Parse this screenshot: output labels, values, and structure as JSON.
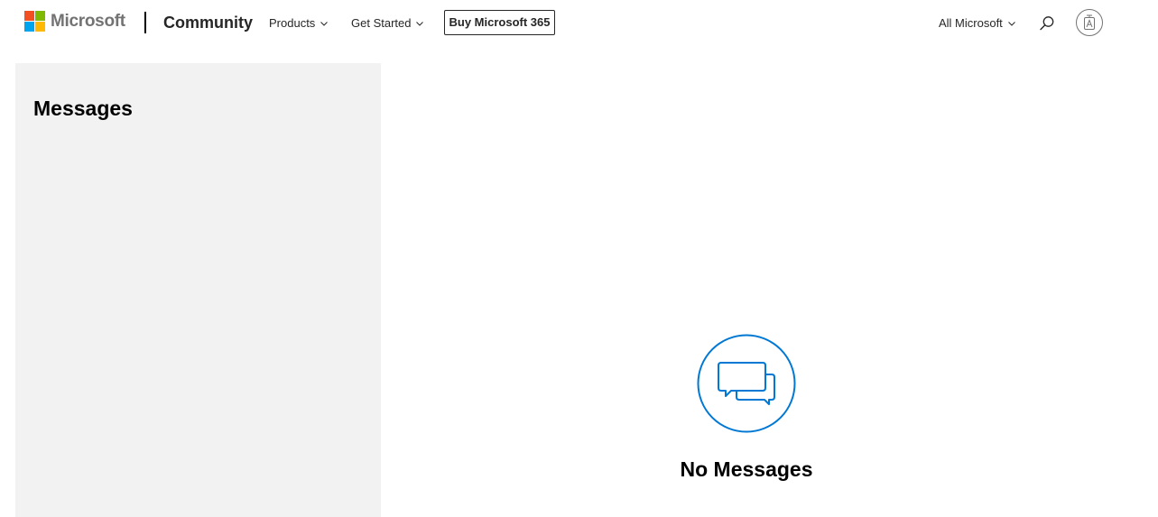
{
  "header": {
    "brand": "Microsoft",
    "site_name": "Community",
    "nav": [
      {
        "label": "Products",
        "icon": "chevron-down-icon"
      },
      {
        "label": "Get Started",
        "icon": "chevron-down-icon"
      }
    ],
    "buy_label": "Buy Microsoft 365",
    "all_microsoft_label": "All Microsoft",
    "search_icon": "search-icon",
    "avatar_icon": "account-avatar-icon"
  },
  "sidebar": {
    "title": "Messages"
  },
  "main": {
    "empty_state_icon": "chat-bubbles-icon",
    "empty_state_text": "No Messages"
  },
  "colors": {
    "ms_red": "#f25022",
    "ms_green": "#7fba00",
    "ms_blue": "#00a4ef",
    "ms_yellow": "#ffb900",
    "accent": "#0078d4",
    "sidebar_bg": "#f2f2f2"
  }
}
